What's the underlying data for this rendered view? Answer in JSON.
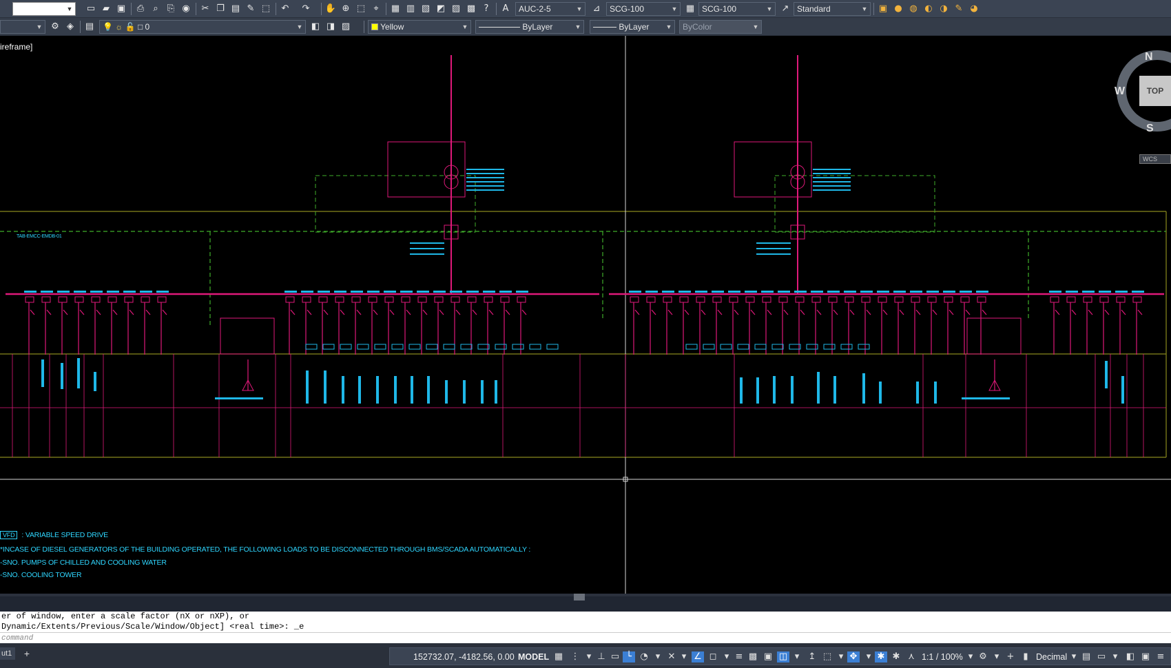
{
  "toolbar_top": {
    "workspace_value": "",
    "text_style": "AUC-2-5",
    "dim_style": "SCG-100",
    "table_style": "SCG-100",
    "mleader_style": "Standard"
  },
  "toolbar_layers": {
    "layer_value": "0",
    "color_value": "Yellow",
    "linetype_value": "ByLayer",
    "lineweight_value": "ByLayer",
    "plotstyle_value": "ByColor"
  },
  "viewport": {
    "label": "ireframe]",
    "viewcube": {
      "n": "N",
      "w": "W",
      "s": "S",
      "face": "TOP",
      "wcs": "WCS"
    },
    "notes": {
      "vfd_box": "VFD",
      "vfd_text": ": VARIABLE SPEED DRIVE",
      "note1": "*INCASE OF DIESEL GENERATORS OF THE BUILDING OPERATED, THE FOLLOWING LOADS TO BE DISCONNECTED THROUGH BMS/SCADA AUTOMATICALLY :",
      "note2": "-SNO. PUMPS OF CHILLED AND COOLING WATER",
      "note3": "-SNO. COOLING TOWER"
    },
    "panel_label": "TAB-EMCC-EMDB-01"
  },
  "command_line": {
    "history_line1": "er of window, enter a scale factor (nX or nXP), or",
    "history_line2": "Dynamic/Extents/Previous/Scale/Window/Object] <real time>: _e",
    "input_placeholder": "command"
  },
  "status_bar": {
    "layout_tab": "ut1",
    "coordinates": "152732.07, -4182.56, 0.00",
    "model_label": "MODEL",
    "scale": "1:1 / 100%",
    "units": "Decimal"
  },
  "colors": {
    "magenta": "#e0197a",
    "cyan": "#1fb8e8",
    "green_dashed": "#3fae2a",
    "olive_line": "#8a8a1c",
    "toolbar_bg": "#3b4453"
  }
}
